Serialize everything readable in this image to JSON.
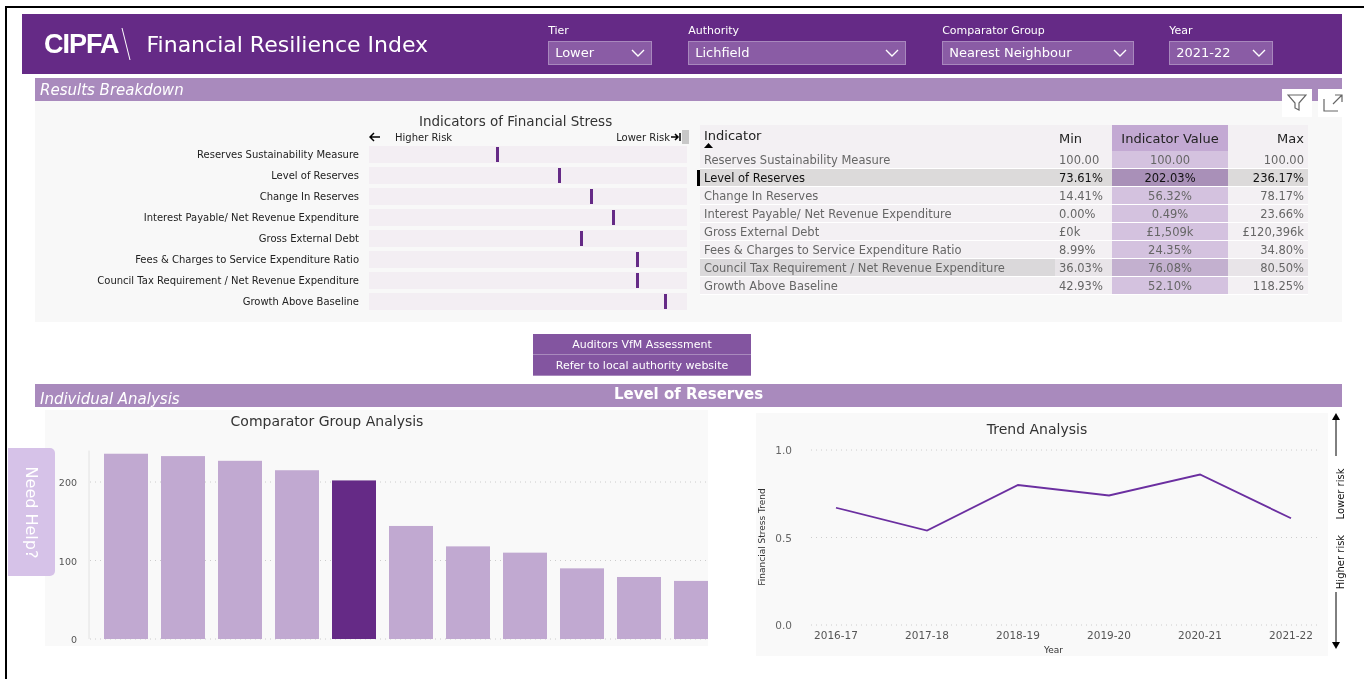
{
  "header": {
    "logo": "CIPFA",
    "title": "Financial Resilience Index",
    "filters": [
      {
        "label": "Tier",
        "value": "Lower"
      },
      {
        "label": "Authority",
        "value": "Lichfield"
      },
      {
        "label": "Comparator Group",
        "value": "Nearest Neighbour"
      },
      {
        "label": "Year",
        "value": "2021-22"
      }
    ]
  },
  "results": {
    "title": "Results Breakdown",
    "stress_chart": {
      "title": "Indicators of Financial Stress",
      "left_label": "Higher Risk",
      "right_label": "Lower Risk",
      "rows": [
        {
          "label": "Reserves Sustainability Measure",
          "level": 0.4
        },
        {
          "label": "Level of Reserves",
          "level": 0.595
        },
        {
          "label": "Change In Reserves",
          "level": 0.695
        },
        {
          "label": "Interest Payable/ Net Revenue Expenditure",
          "level": 0.763
        },
        {
          "label": "Gross External Debt",
          "level": 0.663
        },
        {
          "label": "Fees & Charges to Service Expenditure Ratio",
          "level": 0.84
        },
        {
          "label": "Council Tax Requirement / Net Revenue Expenditure",
          "level": 0.84
        },
        {
          "label": "Growth Above Baseline",
          "level": 0.927
        }
      ]
    },
    "table": {
      "columns": [
        {
          "label": "Indicator",
          "sorted": true
        },
        {
          "label": "Min",
          "sorted": false
        },
        {
          "label": "Indicator Value",
          "sorted": false
        },
        {
          "label": "Max",
          "sorted": false
        }
      ],
      "rows": [
        {
          "indicator": "Reserves Sustainability Measure",
          "min": "100.00",
          "value": "100.00",
          "max": "100.00",
          "selected": false,
          "highlighted": false
        },
        {
          "indicator": "Level of Reserves",
          "min": "73.61%",
          "value": "202.03%",
          "max": "236.17%",
          "selected": true,
          "highlighted": false
        },
        {
          "indicator": "Change In Reserves",
          "min": "14.41%",
          "value": "56.32%",
          "max": "78.17%",
          "selected": false,
          "highlighted": false
        },
        {
          "indicator": "Interest Payable/ Net Revenue Expenditure",
          "min": "0.00%",
          "value": "0.49%",
          "max": "23.66%",
          "selected": false,
          "highlighted": false
        },
        {
          "indicator": "Gross External Debt",
          "min": "£0k",
          "value": "£1,509k",
          "max": "£120,396k",
          "selected": false,
          "highlighted": false
        },
        {
          "indicator": "Fees & Charges to Service Expenditure Ratio",
          "min": "8.99%",
          "value": "24.35%",
          "max": "34.80%",
          "selected": false,
          "highlighted": false
        },
        {
          "indicator": "Council Tax Requirement / Net Revenue Expenditure",
          "min": "36.03%",
          "value": "76.08%",
          "max": "80.50%",
          "selected": false,
          "highlighted": true
        },
        {
          "indicator": "Growth Above Baseline",
          "min": "42.93%",
          "value": "52.10%",
          "max": "118.25%",
          "selected": false,
          "highlighted": false
        }
      ]
    }
  },
  "buttons": [
    "Auditors VfM Assessment",
    "Refer to local authority website"
  ],
  "individual": {
    "title": "Individual Analysis",
    "subject": "Level of Reserves",
    "comparator": {
      "chart_data": {
        "type": "bar",
        "title": "Comparator Group Analysis",
        "ylim": [
          0,
          240
        ],
        "yticks": [
          0,
          100,
          200
        ],
        "series": [
          {
            "color": "#c1a9d1",
            "values": [
              236,
              233,
              227,
              215,
              null,
              144,
              118,
              110,
              90,
              79,
              74
            ]
          },
          {
            "color": "#652a86",
            "values": [
              null,
              null,
              null,
              null,
              202,
              null,
              null,
              null,
              null,
              null,
              null
            ]
          }
        ]
      }
    },
    "trend": {
      "chart_data": {
        "type": "line",
        "title": "Trend Analysis",
        "xlabel": "Year",
        "ylabel": "Financial Stress Trend",
        "categories": [
          "2016-17",
          "2017-18",
          "2018-19",
          "2019-20",
          "2020-21",
          "2021-22"
        ],
        "ylim": [
          0,
          1
        ],
        "yticks": [
          {
            "value": 0,
            "label": "0.0"
          },
          {
            "value": 0.5,
            "label": "0.5"
          },
          {
            "value": 1,
            "label": "1.0"
          }
        ],
        "series": [
          {
            "color": "#6b2fa0",
            "values": [
              0.67,
              0.54,
              0.8,
              0.74,
              0.86,
              0.61
            ]
          }
        ]
      },
      "upper_label": "Lower risk",
      "lower_label": "Higher risk"
    }
  },
  "help_tab": "Need Help?"
}
